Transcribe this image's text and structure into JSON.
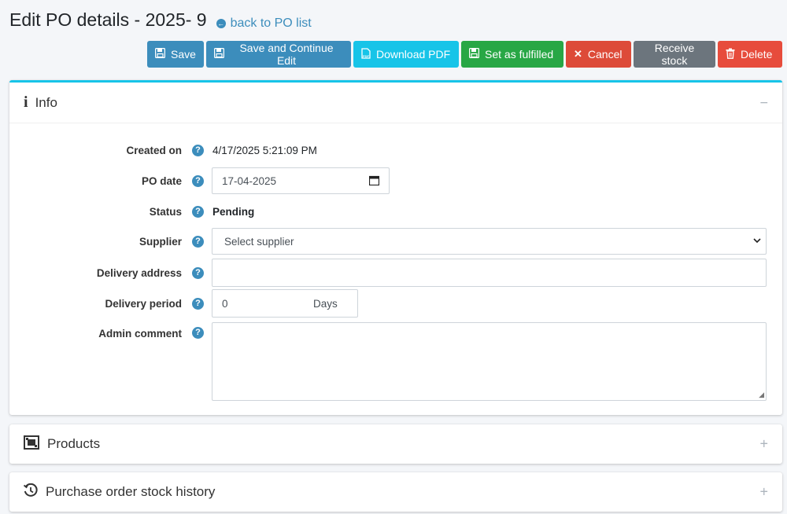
{
  "page": {
    "title": "Edit PO details - 2025- 9",
    "back_link": "back to PO list"
  },
  "toolbar": {
    "save": "Save",
    "save_continue": "Save and Continue Edit",
    "download_pdf": "Download PDF",
    "set_fulfilled": "Set as fulfilled",
    "cancel": "Cancel",
    "receive_stock": "Receive stock",
    "delete": "Delete"
  },
  "info_card": {
    "title": "Info",
    "collapse_icon": "−",
    "fields": {
      "created_on": {
        "label": "Created on",
        "value": "4/17/2025 5:21:09 PM"
      },
      "po_date": {
        "label": "PO date",
        "value": "17-04-2025"
      },
      "status": {
        "label": "Status",
        "value": "Pending"
      },
      "supplier": {
        "label": "Supplier",
        "value": "Select supplier"
      },
      "delivery_address": {
        "label": "Delivery address",
        "value": ""
      },
      "delivery_period": {
        "label": "Delivery period",
        "value": "0",
        "unit": "Days"
      },
      "admin_comment": {
        "label": "Admin comment",
        "value": ""
      }
    },
    "help_icon": "?"
  },
  "products_card": {
    "title": "Products",
    "expand_icon": "+"
  },
  "history_card": {
    "title": "Purchase order stock history",
    "expand_icon": "+"
  },
  "colors": {
    "primary": "#3c8dbc",
    "info": "#17c4e8",
    "success": "#28a745",
    "danger": "#dd4b39",
    "secondary": "#6c757d"
  }
}
